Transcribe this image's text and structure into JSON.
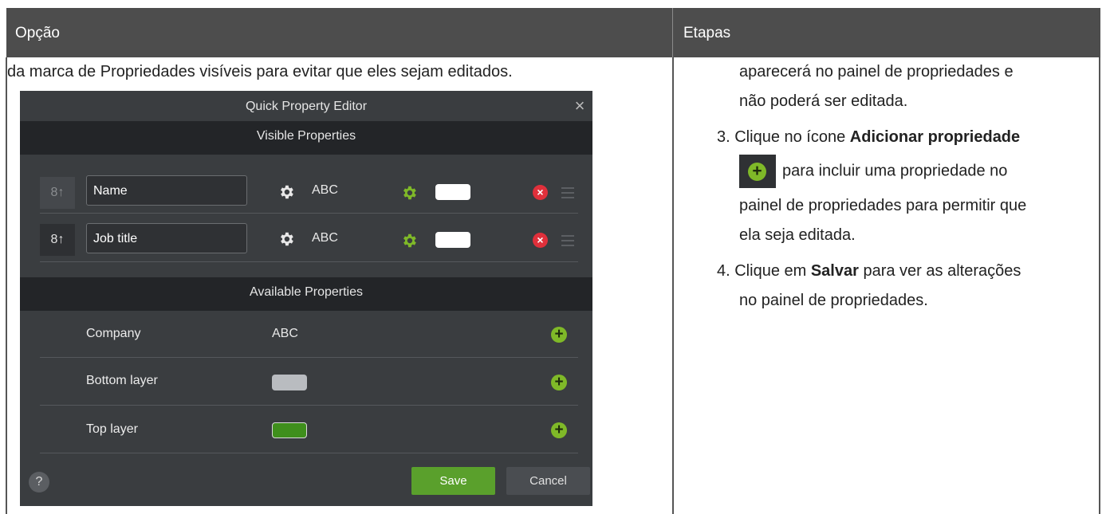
{
  "table": {
    "col_option": "Opção",
    "col_steps": "Etapas"
  },
  "left": {
    "text": "da marca de Propriedades visíveis para evitar que eles sejam editados."
  },
  "dialog": {
    "title": "Quick Property Editor",
    "close": "×",
    "visible_header": "Visible Properties",
    "available_header": "Available Properties",
    "visible": [
      {
        "name": "Name",
        "type": "ABC",
        "link_icon": "unlink-icon",
        "linked": false
      },
      {
        "name": "Job title",
        "type": "ABC",
        "link_icon": "link-icon",
        "linked": true
      }
    ],
    "available": [
      {
        "name": "Company",
        "value": "ABC"
      },
      {
        "name": "Bottom layer",
        "swatch_color": "#b9bcc0"
      },
      {
        "name": "Top layer",
        "swatch_color": "#3f8f1c"
      }
    ],
    "help": "?",
    "save": "Save",
    "cancel": "Cancel",
    "link_glyph": "8↑"
  },
  "steps": {
    "line1": "aparecerá no painel de propriedades e",
    "line2": "não poderá ser editada.",
    "s3_prefix": "3. Clique no ícone ",
    "s3_bold": "Adicionar propriedade",
    "s3_after_icon": "para incluir uma propriedade no",
    "s3_line3": "painel de propriedades para permitir que",
    "s3_line4": "ela seja editada.",
    "s4_prefix": "4. Clique em ",
    "s4_bold": "Salvar",
    "s4_suffix": " para ver as alterações",
    "s4_line2": "no painel de propriedades."
  },
  "colors": {
    "header_bg": "#4d4d4d",
    "dialog_bg": "#3a3d40",
    "accent_green": "#5aa02c",
    "delete_red": "#e0303b"
  }
}
